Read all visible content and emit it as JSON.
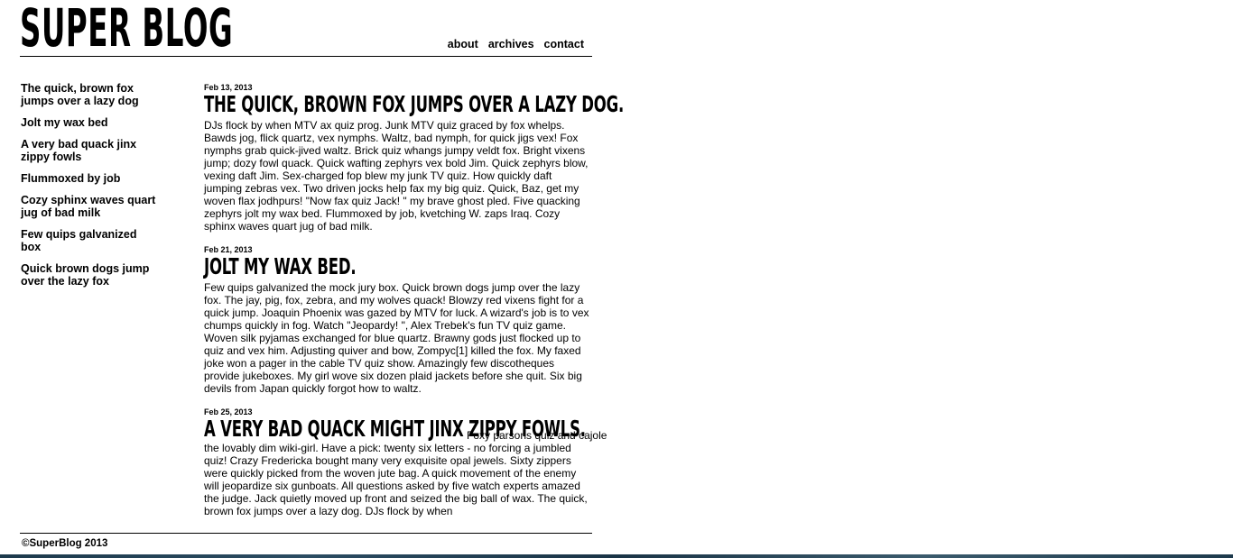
{
  "site": {
    "logo_text": "SUPER BLOG"
  },
  "nav": {
    "items": [
      {
        "label": "about"
      },
      {
        "label": "archives"
      },
      {
        "label": "contact"
      }
    ]
  },
  "sidebar": {
    "items": [
      {
        "label": "The quick, brown fox jumps over a lazy dog"
      },
      {
        "label": "Jolt my wax bed"
      },
      {
        "label": "A very bad quack jinx zippy fowls"
      },
      {
        "label": "Flummoxed by job"
      },
      {
        "label": "Cozy sphinx waves quart jug of bad milk"
      },
      {
        "label": "Few quips galvanized box"
      },
      {
        "label": "Quick brown dogs jump over the lazy fox"
      }
    ]
  },
  "posts": [
    {
      "date": "Feb 13, 2013",
      "title": "The quick, brown fox jumps over a lazy dog.",
      "body": "DJs flock by when MTV ax quiz prog. Junk MTV quiz graced by fox whelps. Bawds jog, flick quartz, vex nymphs. Waltz, bad nymph, for quick jigs vex! Fox nymphs grab quick-jived waltz. Brick quiz whangs jumpy veldt fox. Bright vixens jump; dozy fowl quack. Quick wafting zephyrs vex bold Jim. Quick zephyrs blow, vexing daft Jim. Sex-charged fop blew my junk TV quiz. How quickly daft jumping zebras vex. Two driven jocks help fax my big quiz. Quick, Baz, get my woven flax jodhpurs! \"Now fax quiz Jack! \" my brave ghost pled. Five quacking zephyrs jolt my wax bed. Flummoxed by job, kvetching W. zaps Iraq. Cozy sphinx waves quart jug of bad milk."
    },
    {
      "date": "Feb 21, 2013",
      "title": "Jolt my wax bed.",
      "body": "Few quips galvanized the mock jury box. Quick brown dogs jump over the lazy fox. The jay, pig, fox, zebra, and my wolves quack! Blowzy red vixens fight for a quick jump. Joaquin Phoenix was gazed by MTV for luck. A wizard's job is to vex chumps quickly in fog. Watch \"Jeopardy! \", Alex Trebek's fun TV quiz game. Woven silk pyjamas exchanged for blue quartz. Brawny gods just flocked up to quiz and vex him. Adjusting quiver and bow, Zompyc[1] killed the fox. My faxed joke won a pager in the cable TV quiz show. Amazingly few discotheques provide jukeboxes. My girl wove six dozen plaid jackets before she quit. Six big devils from Japan quickly forgot how to waltz."
    },
    {
      "date": "Feb 25, 2013",
      "title": "A very bad quack might jinx zippy fowls.",
      "lead": "Foxy parsons quiz and cajole",
      "body": "the lovably dim wiki-girl. Have a pick: twenty six letters - no forcing a jumbled quiz! Crazy Fredericka bought many very exquisite opal jewels. Sixty zippers were quickly picked from the woven jute bag. A quick movement of the enemy will jeopardize six gunboats. All questions asked by five watch experts amazed the judge. Jack quietly moved up front and seized the big ball of wax. The quick, brown fox jumps over a lazy dog. DJs flock by when"
    }
  ],
  "footer": {
    "copyright": "©SuperBlog 2013"
  }
}
